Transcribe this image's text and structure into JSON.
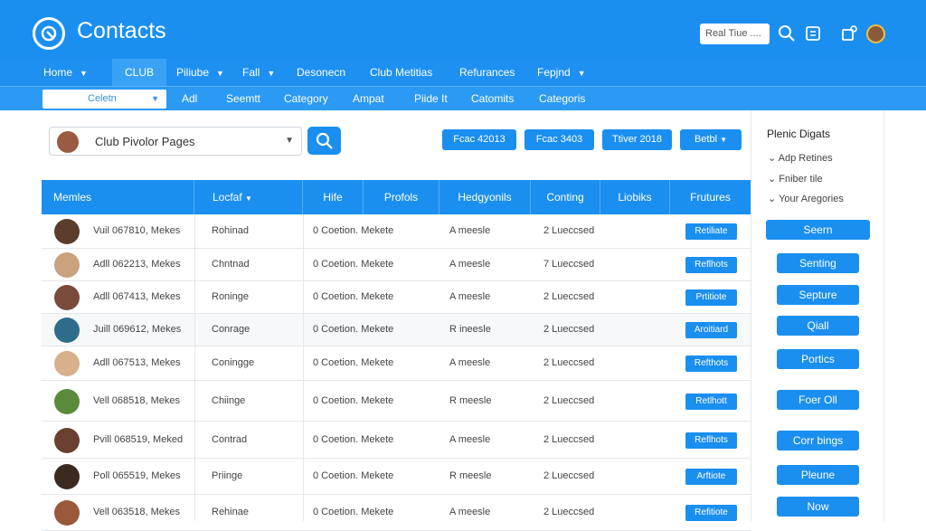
{
  "header": {
    "title": "Contacts",
    "search_value": "Real Tiue ....",
    "icons": [
      "search-icon",
      "settings-icon",
      "account-icon"
    ]
  },
  "nav_primary": [
    {
      "label": "Home",
      "caret": true
    },
    {
      "label": "CLUB",
      "caret": false,
      "active": true
    },
    {
      "label": "Piliube",
      "caret": true
    },
    {
      "label": "Fall",
      "caret": true
    },
    {
      "label": "Desonecn",
      "caret": false
    },
    {
      "label": "Club Metitias",
      "caret": false
    },
    {
      "label": "Refurances",
      "caret": false
    },
    {
      "label": "Fepjnd",
      "caret": true
    }
  ],
  "nav_secondary": {
    "select_label": "Celetn",
    "items": [
      "Adl",
      "Seemtt",
      "Category",
      "Ampat",
      "Piide It",
      "Catomits",
      "Categoris"
    ]
  },
  "toolbar": {
    "select_value": "Club Pivolor Pages",
    "pills": [
      "Fcac 42013",
      "Fcac 3403",
      "Ttiver 2018",
      "Betbl"
    ]
  },
  "table": {
    "columns": [
      "Memles",
      "Locfaf",
      "Hife",
      "Profols",
      "Hedgyonils",
      "Conting",
      "Liobiks",
      "Frutures"
    ],
    "rows": [
      {
        "name": "Vuil 067810, Mekes",
        "loc": "Rohinad",
        "info": "0 Coetion. Mekete",
        "status": "A meesle",
        "count": "2 Lueccsed",
        "action": "Retiliate"
      },
      {
        "name": "Adll 062213, Mekes",
        "loc": "Chntnad",
        "info": "0 Coetion. Mekete",
        "status": "A meesle",
        "count": "7 Lueccsed",
        "action": "Reflhots"
      },
      {
        "name": "Adll 067413, Mekes",
        "loc": "Roninge",
        "info": "0 Coetion. Mekete",
        "status": "A meesle",
        "count": "2 Lueccsed",
        "action": "Prtitiote"
      },
      {
        "name": "Juill 069612, Mekes",
        "loc": "Conrage",
        "info": "0 Coetion. Mekete",
        "status": "R ineesle",
        "count": "2 Lueccsed",
        "action": "Aroitiard"
      },
      {
        "name": "Adll 067513, Mekes",
        "loc": "Coningge",
        "info": "0 Coetion. Mekete",
        "status": "A meesle",
        "count": "2 Lueccsed",
        "action": "Refthots"
      },
      {
        "name": "Vell 068518, Mekes",
        "loc": "Chiinge",
        "info": "0 Coetion. Mekete",
        "status": "R meesle",
        "count": "2 Lueccsed",
        "action": "Retlhott"
      },
      {
        "name": "Pvill 068519, Meked",
        "loc": "Contrad",
        "info": "0 Coetion. Mekete",
        "status": "A meesle",
        "count": "2 Lueccsed",
        "action": "Reflhots"
      },
      {
        "name": "Poll 065519, Mekes",
        "loc": "Priinge",
        "info": "0 Coetion. Mekete",
        "status": "R meesle",
        "count": "2 Lueccsed",
        "action": "Arftiote"
      },
      {
        "name": "Vell 063518, Mekes",
        "loc": "Rehinae",
        "info": "0 Coetion. Mekete",
        "status": "A meesle",
        "count": "2 Lueccsed",
        "action": "Refitiote"
      }
    ]
  },
  "right_panel": {
    "title": "Plenic Digats",
    "filters": [
      "Adp Retines",
      "Fniber tile",
      "Your Aregories"
    ],
    "buttons": [
      "Seern",
      "Senting",
      "Septure",
      "Qiall",
      "Portics",
      "Foer Oll",
      "Corr bings",
      "Pleune",
      "Now"
    ]
  },
  "colors": {
    "accent": "#1a8ff0",
    "header": "#1a8ff0"
  }
}
